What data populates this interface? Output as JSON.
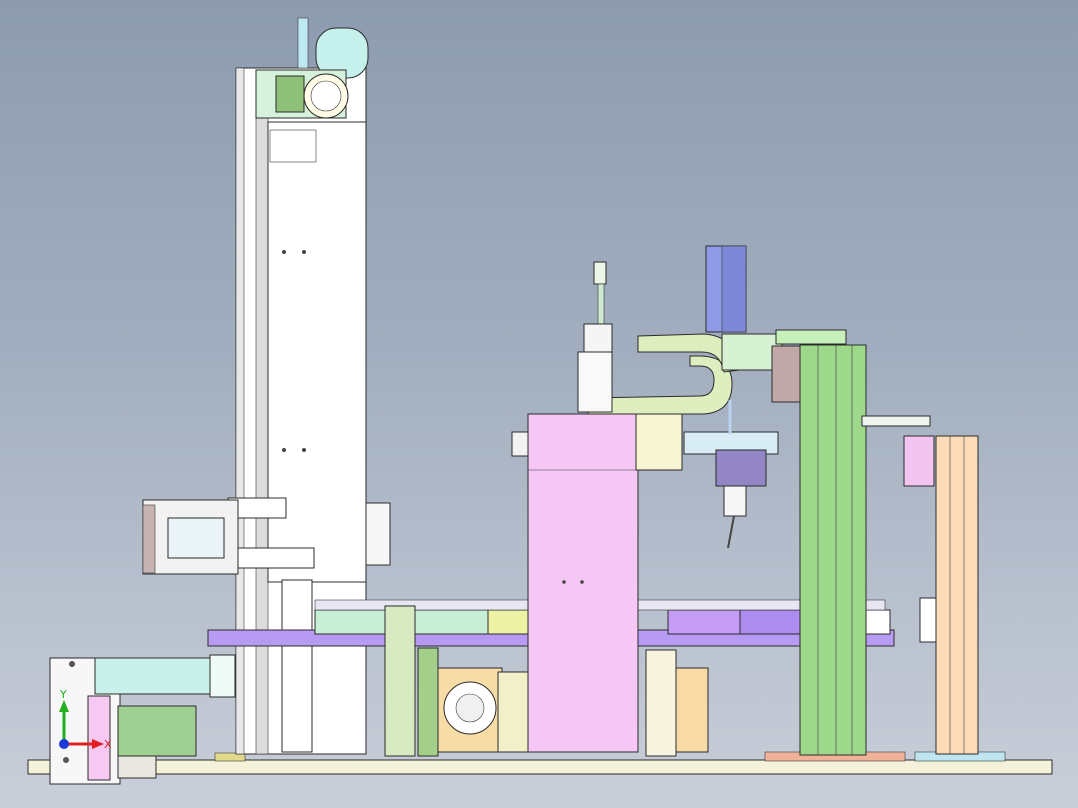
{
  "triad": {
    "x_label": "X",
    "y_label": "Y",
    "x_color": "#e02020",
    "y_color": "#22b022",
    "z_color": "#1a3ad8"
  },
  "palette": {
    "background": "#a3afc0",
    "column": "#ffffff",
    "pink_block": "#f6c6f4",
    "green_column": "#9ed88a",
    "peach_column": "#fcdcb8",
    "purple_plate": "#b89af2",
    "cream_arm": "#dfeebe"
  }
}
